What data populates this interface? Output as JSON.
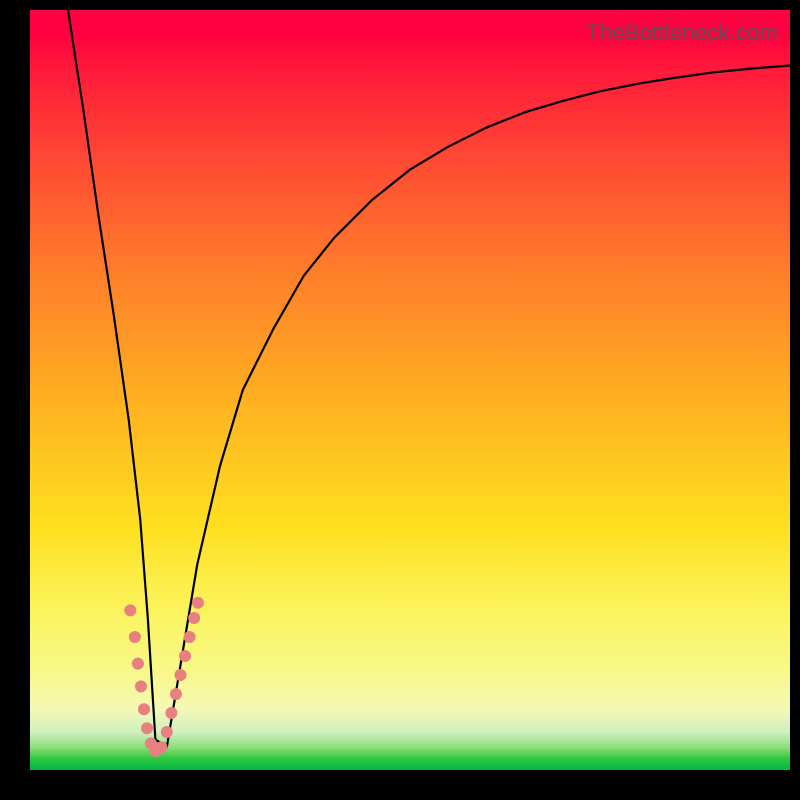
{
  "watermark_text": "TheBottleneck.com",
  "colors": {
    "background_frame": "#000000",
    "curve": "#000000",
    "dot_fill": "#e88080",
    "dot_stroke": "#c05050"
  },
  "chart_data": {
    "type": "line",
    "title": "",
    "xlabel": "",
    "ylabel": "",
    "xlim": [
      0,
      100
    ],
    "ylim": [
      0,
      100
    ],
    "grid": false,
    "annotation_watermark": "TheBottleneck.com",
    "series": [
      {
        "name": "bottleneck-curve",
        "comment": "V-shaped bottleneck curve; left steep linear descent into vertex then log-like rise to the right. y is percentage-like (0 bottom, 100 top). Values estimated from pixels.",
        "x": [
          5,
          7,
          9,
          11,
          13,
          14.5,
          15.5,
          16.5,
          18,
          20,
          22,
          25,
          28,
          32,
          36,
          40,
          45,
          50,
          55,
          60,
          65,
          70,
          75,
          80,
          85,
          90,
          95,
          100
        ],
        "y": [
          100,
          87,
          73,
          60,
          46,
          33,
          20,
          4,
          3,
          15,
          27,
          40,
          50,
          58,
          65,
          70,
          75,
          79,
          82,
          84.5,
          86.5,
          88,
          89.3,
          90.3,
          91.1,
          91.8,
          92.3,
          92.7
        ]
      }
    ],
    "scatter_points": {
      "comment": "Clustered pink dots near the vertex, along both arms, in the low-y (green) region. Values estimated.",
      "points": [
        {
          "x": 13.2,
          "y": 21.0
        },
        {
          "x": 13.8,
          "y": 17.5
        },
        {
          "x": 14.2,
          "y": 14.0
        },
        {
          "x": 14.6,
          "y": 11.0
        },
        {
          "x": 15.0,
          "y": 8.0
        },
        {
          "x": 15.4,
          "y": 5.5
        },
        {
          "x": 15.9,
          "y": 3.5
        },
        {
          "x": 16.5,
          "y": 2.5
        },
        {
          "x": 17.3,
          "y": 3.0
        },
        {
          "x": 18.0,
          "y": 5.0
        },
        {
          "x": 18.6,
          "y": 7.5
        },
        {
          "x": 19.2,
          "y": 10.0
        },
        {
          "x": 19.8,
          "y": 12.5
        },
        {
          "x": 20.4,
          "y": 15.0
        },
        {
          "x": 21.0,
          "y": 17.5
        },
        {
          "x": 21.6,
          "y": 20.0
        },
        {
          "x": 22.1,
          "y": 22.0
        }
      ]
    }
  }
}
